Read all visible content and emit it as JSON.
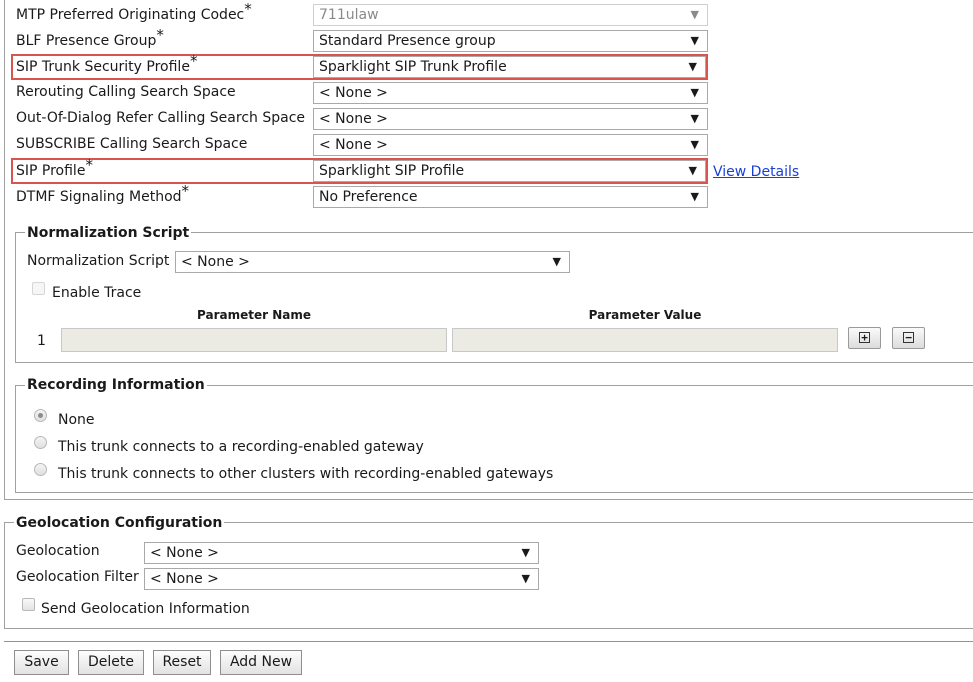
{
  "trunk_settings": {
    "rows": [
      {
        "label": "MTP Preferred Originating Codec",
        "required": "*",
        "value": "711ulaw"
      },
      {
        "label": "BLF Presence Group",
        "required": "*",
        "value": "Standard Presence group"
      },
      {
        "label": "SIP Trunk Security Profile",
        "required": "*",
        "value": "Sparklight SIP Trunk Profile"
      },
      {
        "label": "Rerouting Calling Search Space",
        "required": "",
        "value": "< None >"
      },
      {
        "label": "Out-Of-Dialog Refer Calling Search Space",
        "required": "",
        "value": "< None >"
      },
      {
        "label": "SUBSCRIBE Calling Search Space",
        "required": "",
        "value": "< None >"
      },
      {
        "label": "SIP Profile",
        "required": "*",
        "value": "Sparklight SIP Profile"
      },
      {
        "label": "DTMF Signaling Method",
        "required": "*",
        "value": "No Preference"
      }
    ],
    "view_details_link": "View Details",
    "highlight_color": "#d9534f"
  },
  "normalization": {
    "legend": "Normalization Script",
    "script_label": "Normalization Script",
    "script_value": "< None >",
    "enable_trace_label": "Enable Trace",
    "param_name_header": "Parameter Name",
    "param_value_header": "Parameter Value",
    "row_index": "1",
    "add_icon": "plus-square-icon",
    "remove_icon": "minus-square-icon"
  },
  "recording": {
    "legend": "Recording Information",
    "options": [
      {
        "label": "None",
        "checked": true
      },
      {
        "label": "This trunk connects to a recording-enabled gateway",
        "checked": false
      },
      {
        "label": "This trunk connects to other clusters with recording-enabled gateways",
        "checked": false
      }
    ]
  },
  "geolocation": {
    "legend": "Geolocation Configuration",
    "geolocation_label": "Geolocation",
    "geolocation_value": "< None >",
    "filter_label": "Geolocation Filter",
    "filter_value": "< None >",
    "send_info_label": "Send Geolocation Information"
  },
  "actions": {
    "save": "Save",
    "delete": "Delete",
    "reset": "Reset",
    "add_new": "Add New"
  },
  "dropdown_arrow": "▼"
}
